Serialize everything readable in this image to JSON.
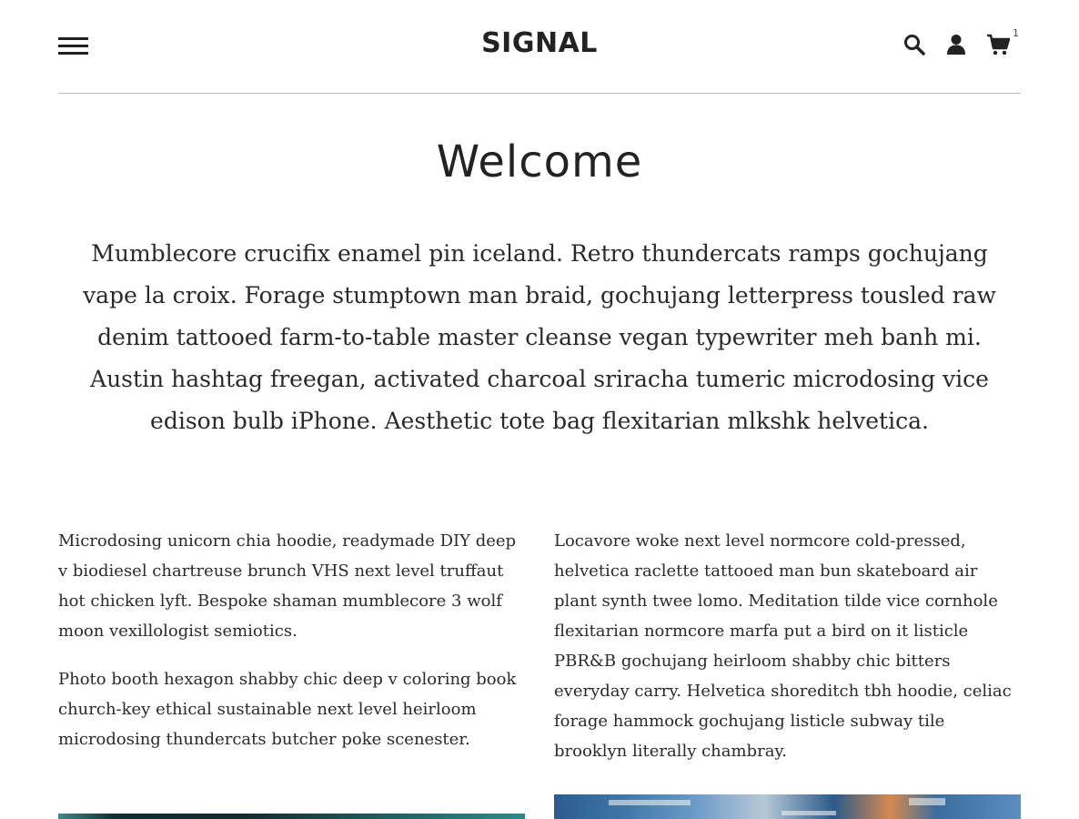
{
  "header": {
    "logo": "SIGNAL",
    "cart_count": "1",
    "icons": [
      "menu-icon",
      "search-icon",
      "account-icon",
      "cart-icon"
    ]
  },
  "main": {
    "title": "Welcome",
    "intro": "Mumblecore crucifix enamel pin iceland. Retro thundercats ramps gochujang vape la croix. Forage stumptown man braid, gochujang letterpress tousled raw denim tattooed farm-to-table master cleanse vegan typewriter meh banh mi. Austin hashtag freegan, activated charcoal sriracha tumeric microdosing vice edison bulb iPhone. Aesthetic tote bag flexitarian mlkshk helvetica.",
    "left_column": {
      "p1": "Microdosing unicorn chia hoodie, readymade DIY deep v biodiesel chartreuse brunch VHS next level truffaut hot chicken lyft. Bespoke shaman mumblecore 3 wolf moon vexillologist semiotics.",
      "p2": "Photo booth hexagon shabby chic deep v coloring book church-key ethical sustainable next level heirloom microdosing thundercats butcher poke scenester."
    },
    "right_column": {
      "p1": "Locavore woke next level normcore cold-pressed, helvetica raclette tattooed man bun skateboard air plant synth twee lomo. Meditation tilde vice cornhole flexitarian normcore marfa put a bird on it listicle PBR&B gochujang heirloom shabby chic bitters everyday carry. Helvetica shoreditch tbh hoodie, celiac forage hammock gochujang listicle subway tile brooklyn literally chambray."
    }
  },
  "colors": {
    "text": "#222222",
    "divider": "#b8b8b8",
    "background": "#ffffff"
  }
}
